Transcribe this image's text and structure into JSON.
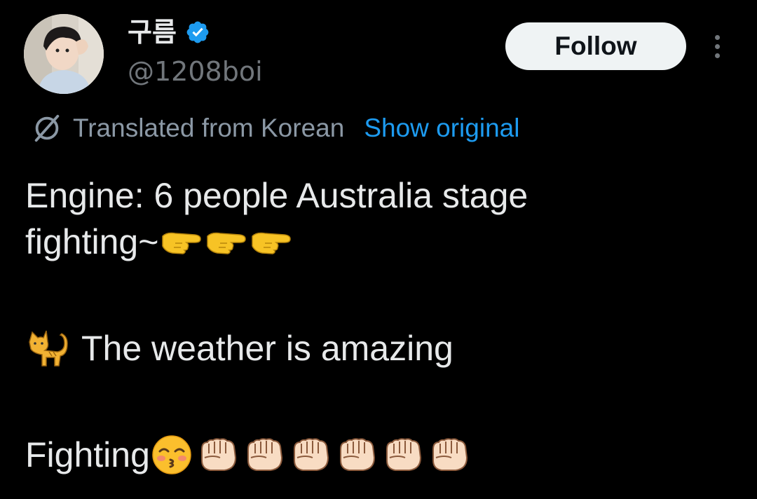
{
  "profile": {
    "display_name": "구름",
    "handle": "@1208boi",
    "avatar_icon": "user-avatar",
    "verified_icon": "verified-badge-icon"
  },
  "actions": {
    "follow_label": "Follow",
    "more_icon": "more-options-icon"
  },
  "translation": {
    "label": "Translated from Korean",
    "show_original": "Show original",
    "icon": "translate-globe-icon"
  },
  "tweet": {
    "line1": "Engine: 6 people Australia stage",
    "line2": "fighting~",
    "line3": "The weather is amazing",
    "line4": "Fighting",
    "emoji": {
      "pointing": "backhand-index-pointing-right",
      "cat": "cat-emoji",
      "kiss": "kissing-face-with-smiling-eyes",
      "fist": "oncoming-fist"
    }
  },
  "colors": {
    "background": "#000000",
    "text_primary": "#e7e9ea",
    "text_secondary": "#71767b",
    "link": "#1d9bf0",
    "verified": "#1d9bf0",
    "follow_bg": "#eff3f4"
  }
}
